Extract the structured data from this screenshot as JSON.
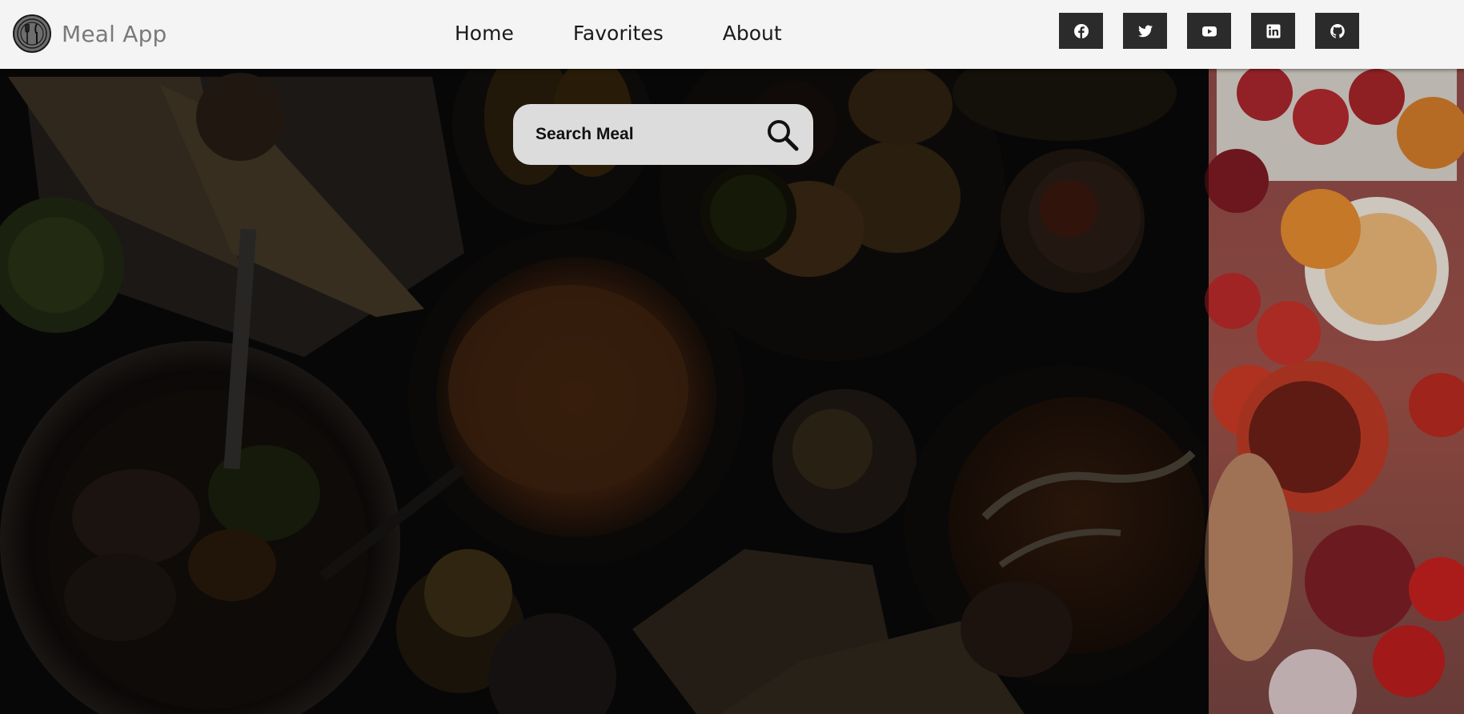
{
  "brand": {
    "name": "Meal App",
    "logo_icon": "fork-knife-plate-icon"
  },
  "nav": {
    "links": [
      {
        "label": "Home"
      },
      {
        "label": "Favorites"
      },
      {
        "label": "About"
      }
    ]
  },
  "socials": [
    {
      "name": "facebook-icon"
    },
    {
      "name": "twitter-icon"
    },
    {
      "name": "youtube-icon"
    },
    {
      "name": "linkedin-icon"
    },
    {
      "name": "github-icon"
    }
  ],
  "search": {
    "placeholder": "Search Meal",
    "value": "",
    "icon": "search-icon"
  },
  "colors": {
    "navbar_bg": "#f4f4f4",
    "social_bg": "#2b2b2b",
    "search_bg": "#dcdcdc",
    "brand_text": "#7a7a7a"
  }
}
